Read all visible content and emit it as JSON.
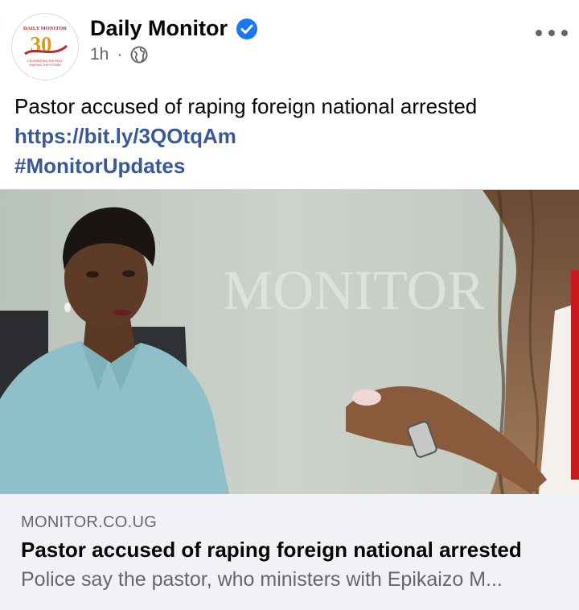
{
  "post": {
    "page_name": "Daily Monitor",
    "verified_icon": "verified-badge-icon",
    "time": "1h",
    "separator": "·",
    "privacy_icon": "globe-icon",
    "text": "Pastor accused of raping foreign national arrested",
    "link": "https://bit.ly/3QOtqAm",
    "hashtag": "#MonitorUpdates"
  },
  "avatar": {
    "brand": "DAILY MONITOR",
    "number": "30",
    "tagline_1": "CELEBRATING THE PAST,",
    "tagline_2": "SHAPING THE FUTURE"
  },
  "image": {
    "watermark": "MONITOR"
  },
  "link_preview": {
    "domain": "MONITOR.CO.UG",
    "headline": "Pastor accused of raping foreign national arrested",
    "description": "Police say the pastor, who ministers with Epikaizo M..."
  },
  "colors": {
    "link": "#385898",
    "verified": "#1877f2",
    "muted": "#65676b",
    "preview_bg": "#f0f2f5"
  }
}
